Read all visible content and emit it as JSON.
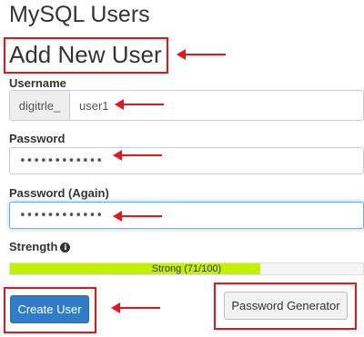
{
  "page_title": "MySQL Users",
  "section_title": "Add New User",
  "username": {
    "label": "Username",
    "prefix": "digitrle_",
    "value": "user1"
  },
  "password": {
    "label": "Password",
    "value": "••••••••••••"
  },
  "password_again": {
    "label": "Password (Again)",
    "value": "••••••••••••"
  },
  "strength": {
    "label": "Strength",
    "text": "Strong (71/100)",
    "score": 71,
    "max": 100
  },
  "buttons": {
    "create_user": "Create User",
    "password_generator": "Password Generator"
  },
  "colors": {
    "annotation_red": "#e8141d",
    "primary_button": "#2f7dc9",
    "strength_fill": "#c4f000",
    "focus_border": "#66afe9"
  },
  "icons": {
    "strength_info": "info-circle-icon",
    "annotation": "red-arrow-icon"
  }
}
